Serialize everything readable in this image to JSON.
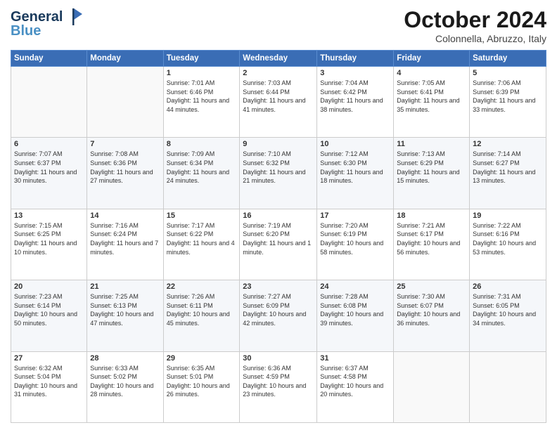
{
  "header": {
    "logo_line1": "General",
    "logo_line2": "Blue",
    "month": "October 2024",
    "location": "Colonnella, Abruzzo, Italy"
  },
  "weekdays": [
    "Sunday",
    "Monday",
    "Tuesday",
    "Wednesday",
    "Thursday",
    "Friday",
    "Saturday"
  ],
  "weeks": [
    [
      {
        "day": "",
        "content": ""
      },
      {
        "day": "",
        "content": ""
      },
      {
        "day": "1",
        "content": "Sunrise: 7:01 AM\nSunset: 6:46 PM\nDaylight: 11 hours and 44 minutes."
      },
      {
        "day": "2",
        "content": "Sunrise: 7:03 AM\nSunset: 6:44 PM\nDaylight: 11 hours and 41 minutes."
      },
      {
        "day": "3",
        "content": "Sunrise: 7:04 AM\nSunset: 6:42 PM\nDaylight: 11 hours and 38 minutes."
      },
      {
        "day": "4",
        "content": "Sunrise: 7:05 AM\nSunset: 6:41 PM\nDaylight: 11 hours and 35 minutes."
      },
      {
        "day": "5",
        "content": "Sunrise: 7:06 AM\nSunset: 6:39 PM\nDaylight: 11 hours and 33 minutes."
      }
    ],
    [
      {
        "day": "6",
        "content": "Sunrise: 7:07 AM\nSunset: 6:37 PM\nDaylight: 11 hours and 30 minutes."
      },
      {
        "day": "7",
        "content": "Sunrise: 7:08 AM\nSunset: 6:36 PM\nDaylight: 11 hours and 27 minutes."
      },
      {
        "day": "8",
        "content": "Sunrise: 7:09 AM\nSunset: 6:34 PM\nDaylight: 11 hours and 24 minutes."
      },
      {
        "day": "9",
        "content": "Sunrise: 7:10 AM\nSunset: 6:32 PM\nDaylight: 11 hours and 21 minutes."
      },
      {
        "day": "10",
        "content": "Sunrise: 7:12 AM\nSunset: 6:30 PM\nDaylight: 11 hours and 18 minutes."
      },
      {
        "day": "11",
        "content": "Sunrise: 7:13 AM\nSunset: 6:29 PM\nDaylight: 11 hours and 15 minutes."
      },
      {
        "day": "12",
        "content": "Sunrise: 7:14 AM\nSunset: 6:27 PM\nDaylight: 11 hours and 13 minutes."
      }
    ],
    [
      {
        "day": "13",
        "content": "Sunrise: 7:15 AM\nSunset: 6:25 PM\nDaylight: 11 hours and 10 minutes."
      },
      {
        "day": "14",
        "content": "Sunrise: 7:16 AM\nSunset: 6:24 PM\nDaylight: 11 hours and 7 minutes."
      },
      {
        "day": "15",
        "content": "Sunrise: 7:17 AM\nSunset: 6:22 PM\nDaylight: 11 hours and 4 minutes."
      },
      {
        "day": "16",
        "content": "Sunrise: 7:19 AM\nSunset: 6:20 PM\nDaylight: 11 hours and 1 minute."
      },
      {
        "day": "17",
        "content": "Sunrise: 7:20 AM\nSunset: 6:19 PM\nDaylight: 10 hours and 58 minutes."
      },
      {
        "day": "18",
        "content": "Sunrise: 7:21 AM\nSunset: 6:17 PM\nDaylight: 10 hours and 56 minutes."
      },
      {
        "day": "19",
        "content": "Sunrise: 7:22 AM\nSunset: 6:16 PM\nDaylight: 10 hours and 53 minutes."
      }
    ],
    [
      {
        "day": "20",
        "content": "Sunrise: 7:23 AM\nSunset: 6:14 PM\nDaylight: 10 hours and 50 minutes."
      },
      {
        "day": "21",
        "content": "Sunrise: 7:25 AM\nSunset: 6:13 PM\nDaylight: 10 hours and 47 minutes."
      },
      {
        "day": "22",
        "content": "Sunrise: 7:26 AM\nSunset: 6:11 PM\nDaylight: 10 hours and 45 minutes."
      },
      {
        "day": "23",
        "content": "Sunrise: 7:27 AM\nSunset: 6:09 PM\nDaylight: 10 hours and 42 minutes."
      },
      {
        "day": "24",
        "content": "Sunrise: 7:28 AM\nSunset: 6:08 PM\nDaylight: 10 hours and 39 minutes."
      },
      {
        "day": "25",
        "content": "Sunrise: 7:30 AM\nSunset: 6:07 PM\nDaylight: 10 hours and 36 minutes."
      },
      {
        "day": "26",
        "content": "Sunrise: 7:31 AM\nSunset: 6:05 PM\nDaylight: 10 hours and 34 minutes."
      }
    ],
    [
      {
        "day": "27",
        "content": "Sunrise: 6:32 AM\nSunset: 5:04 PM\nDaylight: 10 hours and 31 minutes."
      },
      {
        "day": "28",
        "content": "Sunrise: 6:33 AM\nSunset: 5:02 PM\nDaylight: 10 hours and 28 minutes."
      },
      {
        "day": "29",
        "content": "Sunrise: 6:35 AM\nSunset: 5:01 PM\nDaylight: 10 hours and 26 minutes."
      },
      {
        "day": "30",
        "content": "Sunrise: 6:36 AM\nSunset: 4:59 PM\nDaylight: 10 hours and 23 minutes."
      },
      {
        "day": "31",
        "content": "Sunrise: 6:37 AM\nSunset: 4:58 PM\nDaylight: 10 hours and 20 minutes."
      },
      {
        "day": "",
        "content": ""
      },
      {
        "day": "",
        "content": ""
      }
    ]
  ]
}
